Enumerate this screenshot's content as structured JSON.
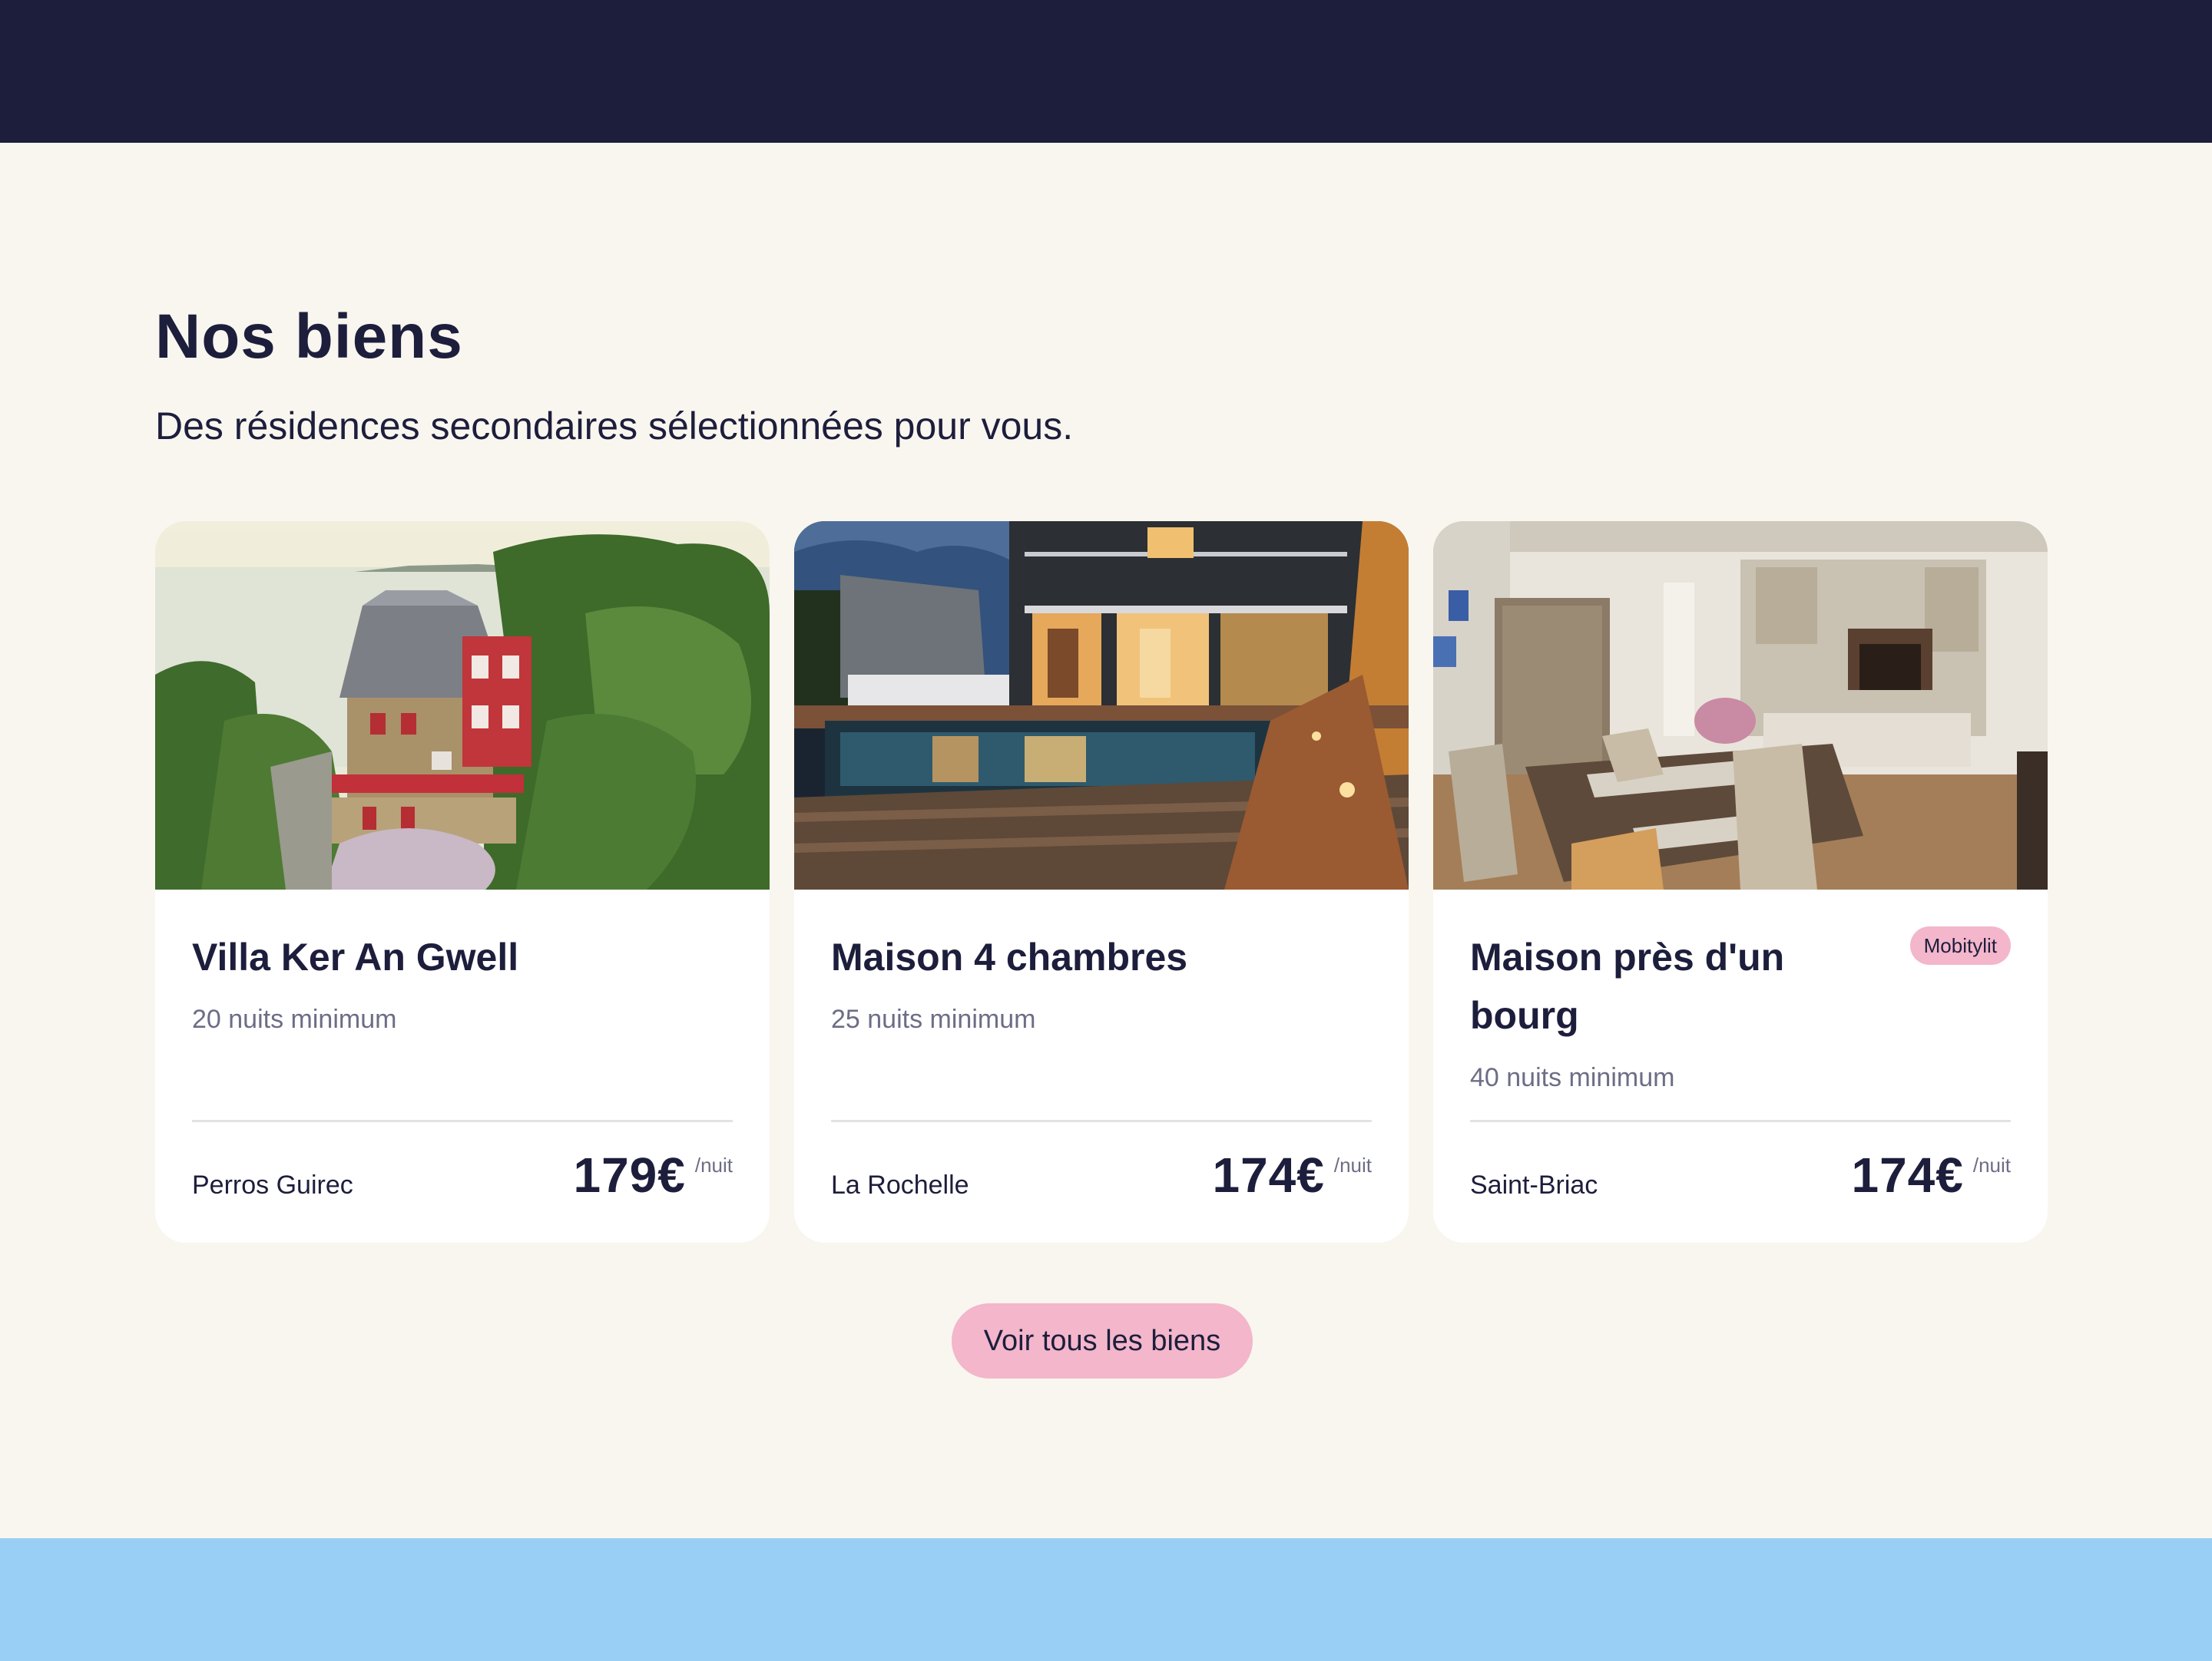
{
  "section": {
    "title": "Nos biens",
    "subtitle": "Des résidences secondaires sélectionnées pour vous."
  },
  "cards": [
    {
      "title": "Villa Ker An Gwell",
      "min_nights": "20 nuits minimum",
      "location": "Perros Guirec",
      "price": "179€",
      "per": "/nuit",
      "badge": ""
    },
    {
      "title": "Maison 4 chambres",
      "min_nights": "25 nuits minimum",
      "location": "La Rochelle",
      "price": "174€",
      "per": "/nuit",
      "badge": ""
    },
    {
      "title": "Maison près d'un bourg",
      "min_nights": "40 nuits minimum",
      "location": "Saint-Briac",
      "price": "174€",
      "per": "/nuit",
      "badge": "Mobitylit"
    }
  ],
  "cta": {
    "label": "Voir tous les biens"
  },
  "colors": {
    "navy": "#1d1e3c",
    "cream": "#f9f6ef",
    "pink": "#f3b6cb",
    "sky": "#99cff4"
  }
}
